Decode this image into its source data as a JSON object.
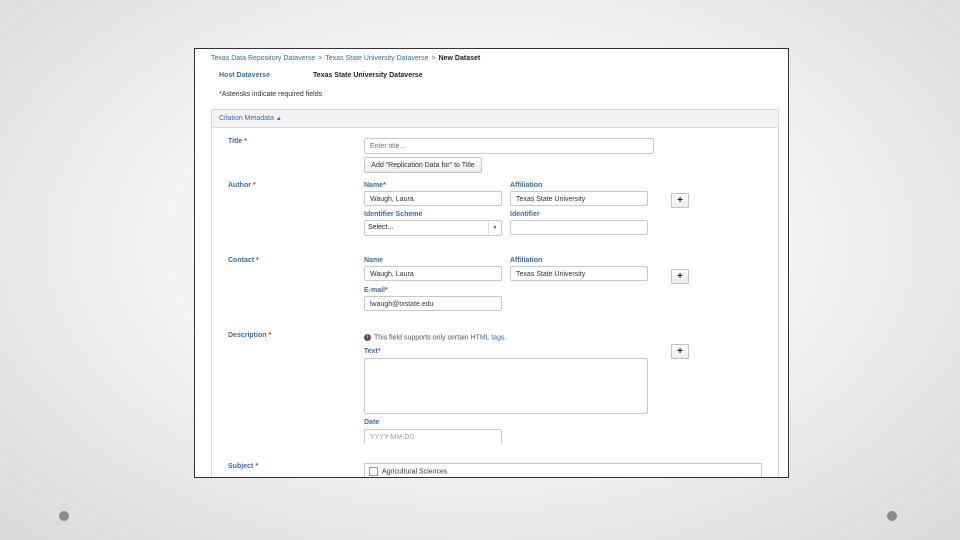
{
  "breadcrumb": {
    "items": [
      "Texas Data Repository Dataverse",
      "Texas State University Dataverse"
    ],
    "separator": ">",
    "current": "New Dataset"
  },
  "host": {
    "label": "Host Dataverse",
    "value": "Texas State University Dataverse"
  },
  "asterisk_note": "*Asterisks indicate required fields",
  "section": {
    "title": "Citation Metadata",
    "toggle_icon": "caret-up-icon"
  },
  "fields": {
    "title": {
      "label": "Title",
      "placeholder": "Enter title...",
      "button": "Add \"Replication Data for\" to Title"
    },
    "author": {
      "label": "Author",
      "name_label": "Name",
      "name_value": "Waugh, Laura",
      "affiliation_label": "Affiliation",
      "affiliation_value": "Texas State University",
      "identifier_scheme_label": "Identifier Scheme",
      "identifier_scheme_value": "Select...",
      "identifier_label": "Identifier"
    },
    "contact": {
      "label": "Contact",
      "name_label": "Name",
      "name_value": "Waugh, Laura",
      "affiliation_label": "Affiliation",
      "affiliation_value": "Texas State University",
      "email_label": "E-mail",
      "email_value": "lwaugh@txstate.edu"
    },
    "description": {
      "label": "Description",
      "note_prefix": "This field supports only certain",
      "note_link": "HTML tags",
      "note_suffix": ".",
      "text_label": "Text",
      "date_label": "Date",
      "date_placeholder": "YYYY-MM-DD"
    },
    "subject": {
      "label": "Subject",
      "first_option": "Agricultural Sciences"
    }
  },
  "required_mark": "*",
  "plus_label": "+",
  "colors": {
    "link": "#3a6ea5",
    "required": "#c9302c",
    "frame_border": "#333333"
  }
}
